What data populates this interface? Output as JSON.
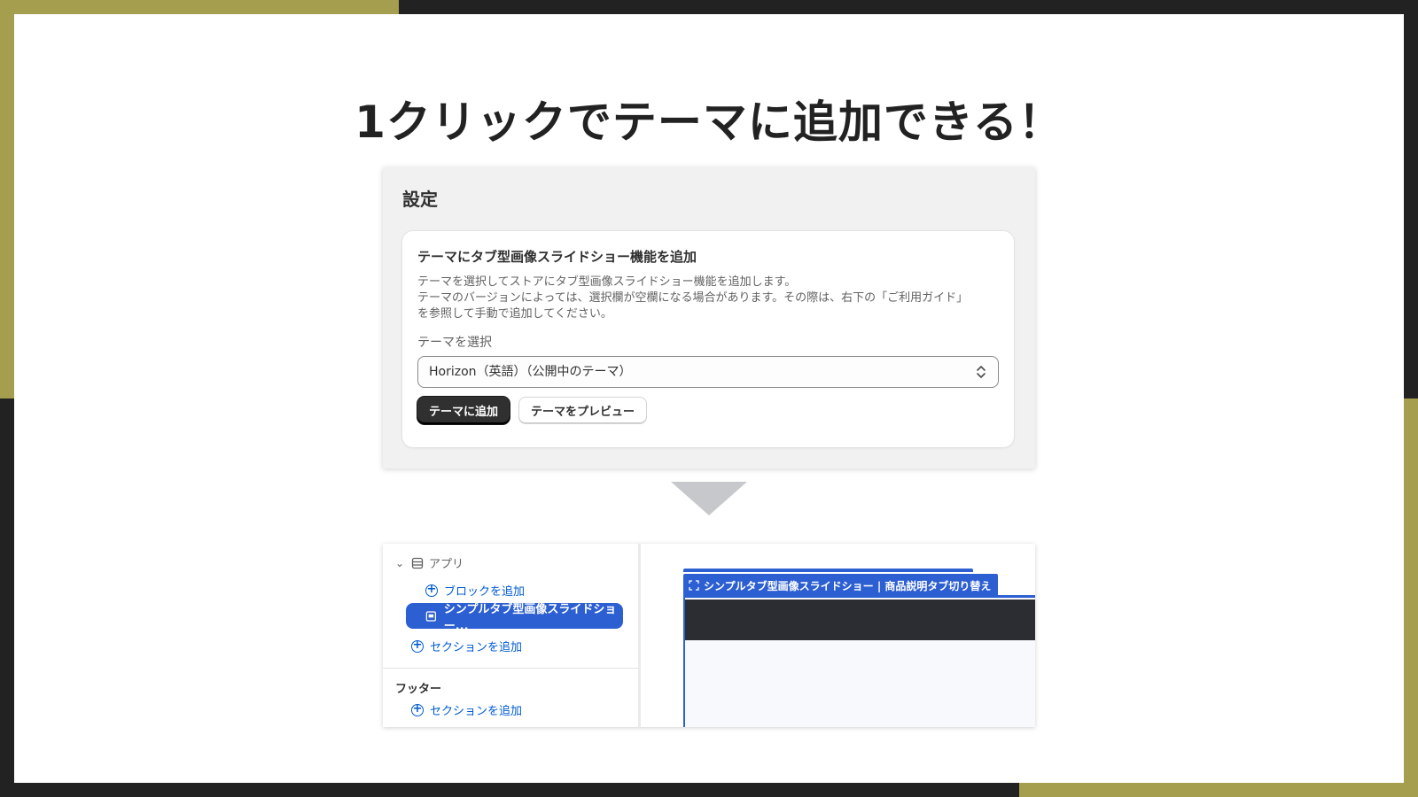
{
  "headline": "1クリックでテーマに追加できる！",
  "settings": {
    "title": "設定",
    "card": {
      "title": "テーマにタブ型画像スライドショー機能を追加",
      "description_lines": [
        "テーマを選択してストアにタブ型画像スライドショー機能を追加します。",
        "テーマのバージョンによっては、選択欄が空欄になる場合があります。その際は、右下の「ご利用ガイド」",
        "を参照して手動で追加してください。"
      ],
      "field_label": "テーマを選択",
      "selected_theme": "Horizon（英語）（公開中のテーマ）",
      "primary_button": "テーマに追加",
      "secondary_button": "テーマをプレビュー"
    }
  },
  "editor": {
    "group_label": "アプリ",
    "add_block": "ブロックを追加",
    "selected_block": "シンプルタブ型画像スライドショー...",
    "add_section": "セクションを追加",
    "footer_label": "フッター",
    "footer_add_section": "セクションを追加",
    "preview_tag": "シンプルタブ型画像スライドショー | 商品説明タブ切り替え"
  },
  "colors": {
    "accent": "#a59e4f",
    "frame": "#222222",
    "selection_blue": "#2c5fd1",
    "link_blue": "#005bd3"
  },
  "icons": [
    "chevron-down-icon",
    "app-block-icon",
    "plus-circle-icon",
    "slideshow-block-icon",
    "selector-icon",
    "section-frame-icon"
  ]
}
